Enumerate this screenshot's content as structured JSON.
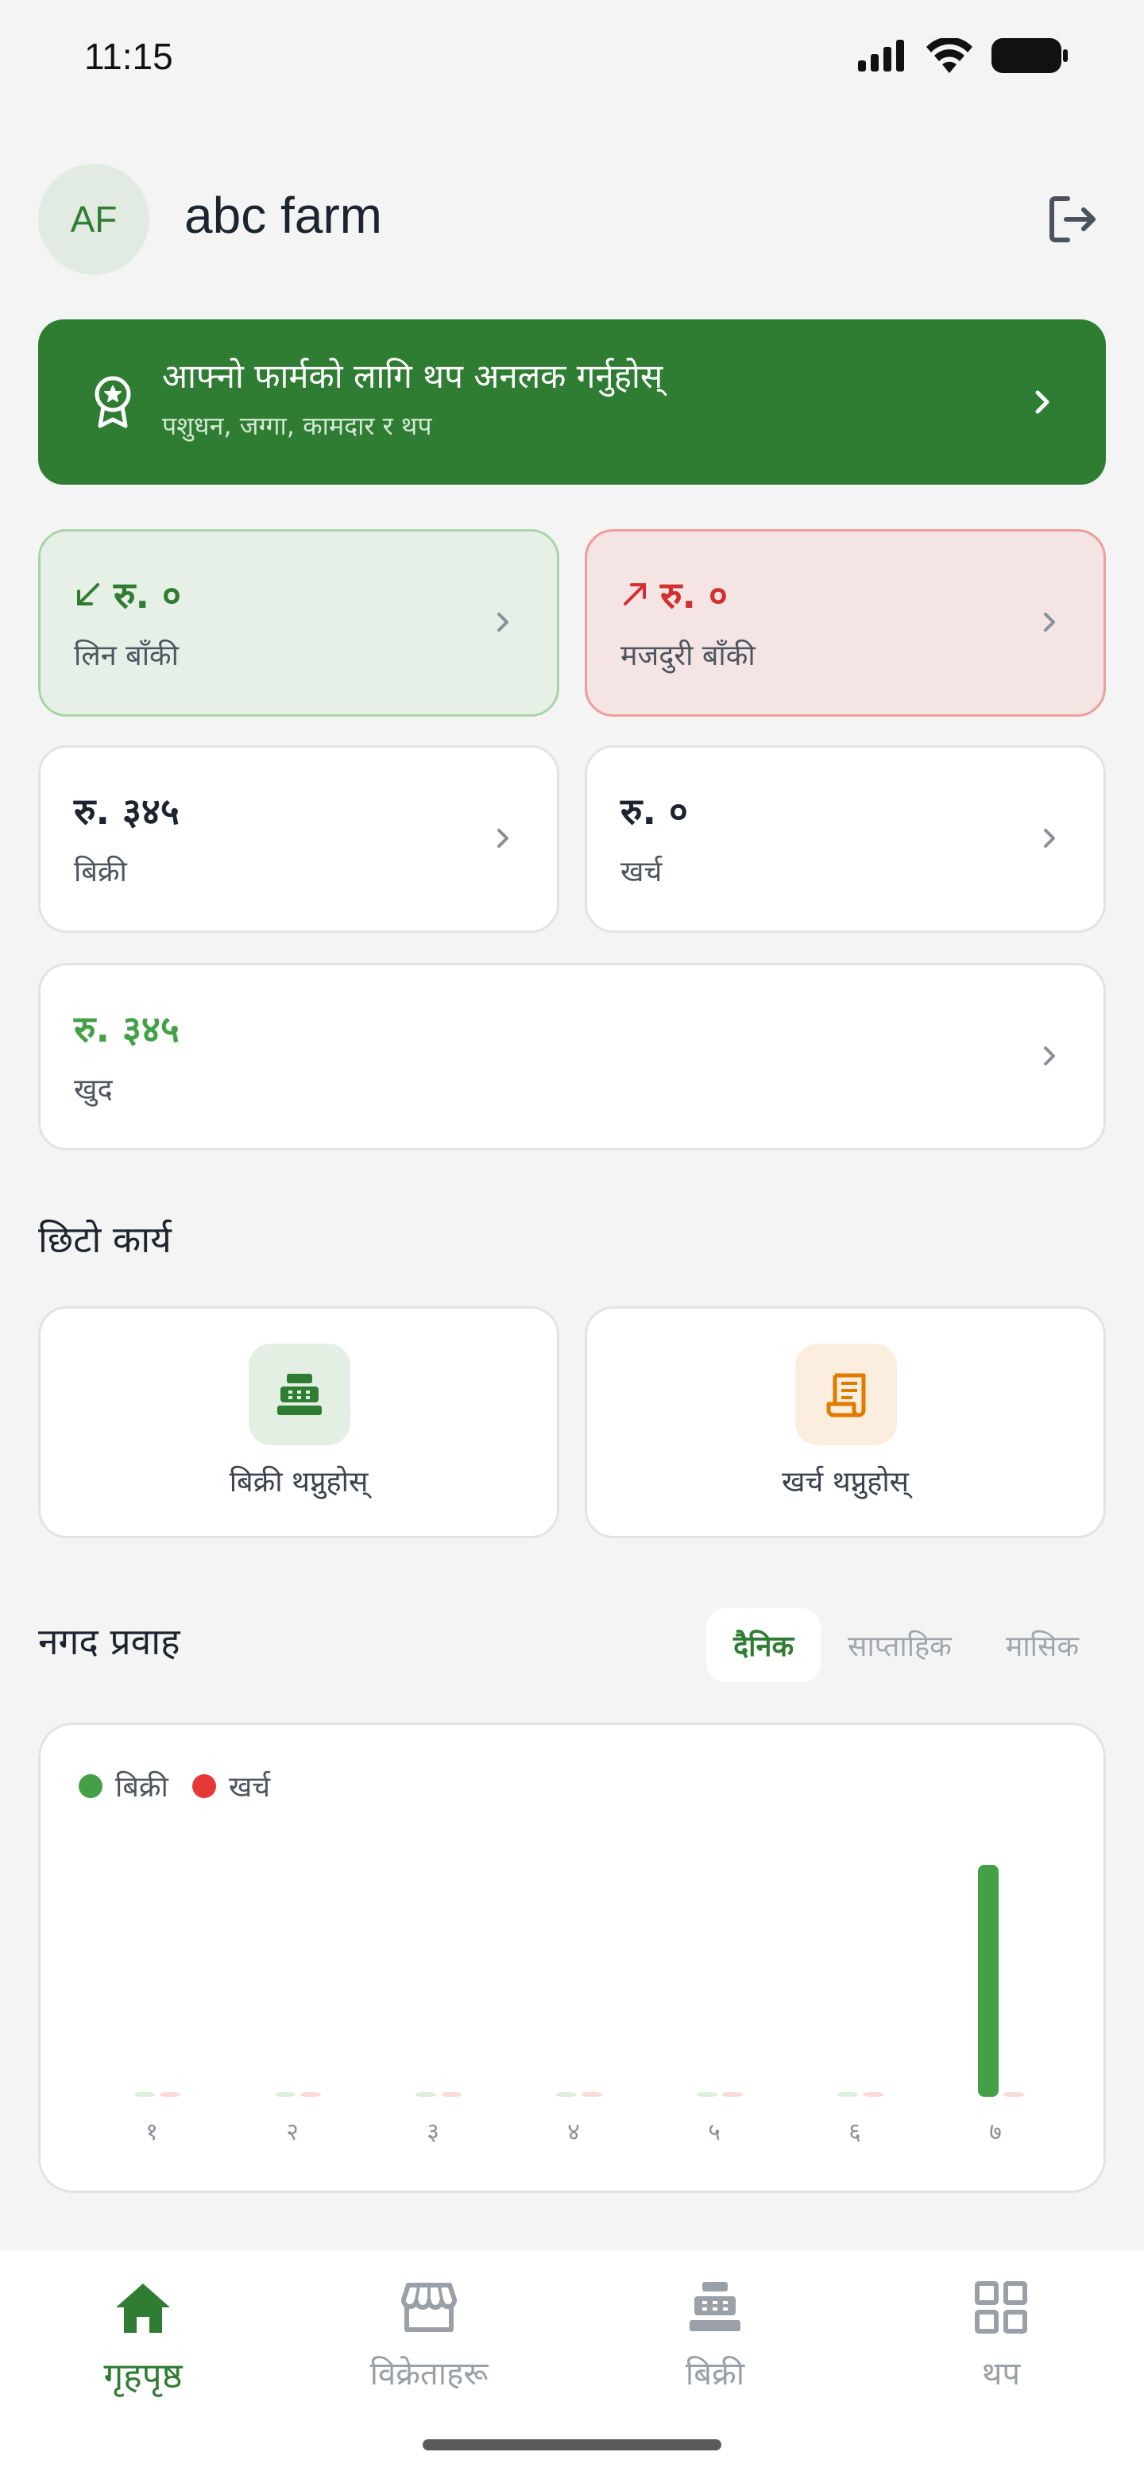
{
  "status": {
    "time": "11:15"
  },
  "header": {
    "avatar_initials": "AF",
    "farm_name": "abc farm"
  },
  "promo": {
    "title": "आफ्नो फार्मको लागि थप अनलक गर्नुहोस्",
    "subtitle": "पशुधन, जग्गा, कामदार र थप"
  },
  "summary": {
    "receivable": {
      "amount": "रु. ०",
      "label": "लिन बाँकी"
    },
    "wages_due": {
      "amount": "रु. ०",
      "label": "मजदुरी बाँकी"
    },
    "sales": {
      "amount": "रु. ३४५",
      "label": "बिक्री"
    },
    "expense": {
      "amount": "रु. ०",
      "label": "खर्च"
    },
    "net": {
      "amount": "रु. ३४५",
      "label": "खुद"
    }
  },
  "quick_actions": {
    "title": "छिटो कार्य",
    "items": [
      {
        "label": "बिक्री थप्नुहोस्",
        "icon": "cash-register-icon"
      },
      {
        "label": "खर्च थप्नुहोस्",
        "icon": "receipt-icon"
      }
    ]
  },
  "cash_flow": {
    "title": "नगद प्रवाह",
    "tabs": [
      "दैनिक",
      "साप्ताहिक",
      "मासिक"
    ],
    "active_tab": "दैनिक"
  },
  "chart_data": {
    "type": "bar",
    "categories": [
      "१",
      "२",
      "३",
      "४",
      "५",
      "६",
      "७"
    ],
    "series": [
      {
        "name": "बिक्री",
        "color": "#43a047",
        "values": [
          0,
          0,
          0,
          0,
          0,
          0,
          345
        ]
      },
      {
        "name": "खर्च",
        "color": "#e53935",
        "values": [
          0,
          0,
          0,
          0,
          0,
          0,
          0
        ]
      }
    ],
    "legend": "top-left",
    "grid": false
  },
  "nav": {
    "items": [
      {
        "label": "गृहपृष्ठ",
        "icon": "home-icon",
        "active": true
      },
      {
        "label": "विक्रेताहरू",
        "icon": "store-icon",
        "active": false
      },
      {
        "label": "बिक्री",
        "icon": "cash-register-icon",
        "active": false
      },
      {
        "label": "थप",
        "icon": "grid-icon",
        "active": false
      }
    ]
  },
  "colors": {
    "brand": "#2e7d32",
    "income": "#43a047",
    "expense": "#e53935"
  }
}
